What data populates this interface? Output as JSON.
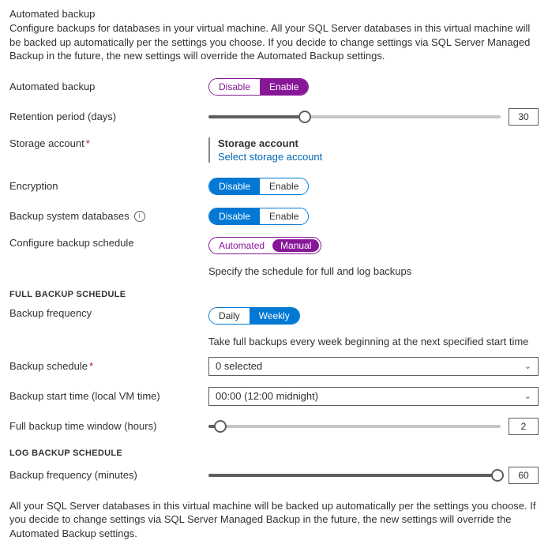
{
  "header": {
    "title": "Automated backup",
    "description": "Configure backups for databases in your virtual machine. All your SQL Server databases in this virtual machine will be backed up automatically per the settings you choose. If you decide to change settings via SQL Server Managed Backup in the future, the new settings will override the Automated Backup settings."
  },
  "automated_backup": {
    "label": "Automated backup",
    "disable": "Disable",
    "enable": "Enable"
  },
  "retention": {
    "label": "Retention period (days)",
    "value": "30"
  },
  "storage": {
    "label": "Storage account",
    "title": "Storage account",
    "link": "Select storage account"
  },
  "encryption": {
    "label": "Encryption",
    "disable": "Disable",
    "enable": "Enable"
  },
  "sysdb": {
    "label": "Backup system databases",
    "disable": "Disable",
    "enable": "Enable"
  },
  "schedule": {
    "label": "Configure backup schedule",
    "auto": "Automated",
    "manual": "Manual",
    "hint": "Specify the schedule for full and log backups"
  },
  "full_heading": "FULL BACKUP SCHEDULE",
  "freq": {
    "label": "Backup frequency",
    "daily": "Daily",
    "weekly": "Weekly",
    "hint": "Take full backups every week beginning at the next specified start time"
  },
  "bschedule": {
    "label": "Backup schedule",
    "value": "0 selected"
  },
  "starttime": {
    "label": "Backup start time (local VM time)",
    "value": "00:00 (12:00 midnight)"
  },
  "window": {
    "label": "Full backup time window (hours)",
    "value": "2"
  },
  "log_heading": "LOG BACKUP SCHEDULE",
  "logfreq": {
    "label": "Backup frequency (minutes)",
    "value": "60"
  },
  "footer": "All your SQL Server databases in this virtual machine will be backed up automatically per the settings you choose. If you decide to change settings via SQL Server Managed Backup in the future, the new settings will override the Automated Backup settings."
}
